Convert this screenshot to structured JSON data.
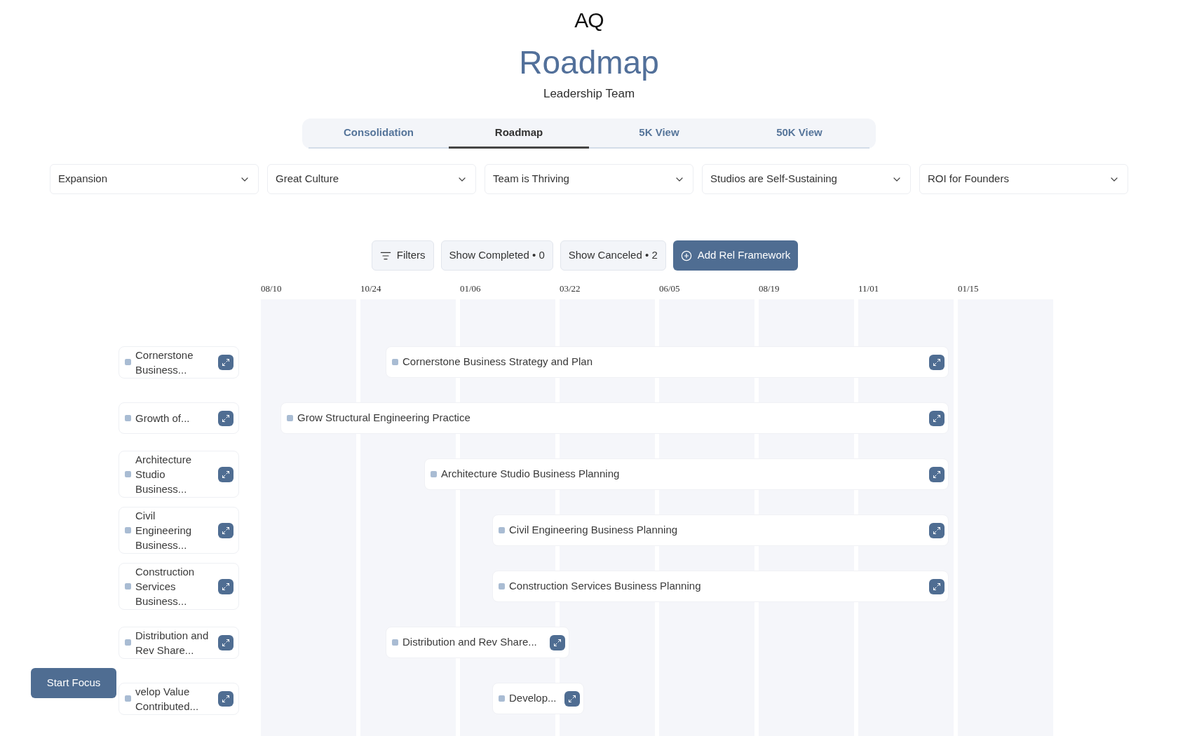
{
  "logo": "AQ",
  "title": "Roadmap",
  "subtitle": "Leadership Team",
  "tabs": [
    {
      "label": "Consolidation",
      "selected": false
    },
    {
      "label": "Roadmap",
      "selected": true
    },
    {
      "label": "5K View",
      "selected": false
    },
    {
      "label": "50K View",
      "selected": false
    }
  ],
  "goal_selects": [
    "Expansion",
    "Great Culture",
    "Team is Thriving",
    "Studios are Self-Sustaining",
    "ROI for Founders"
  ],
  "toolbar": [
    {
      "kind": "filter",
      "label": "Filters"
    },
    {
      "kind": "toggle",
      "label": "Show Completed • 0"
    },
    {
      "kind": "toggle",
      "label": "Show Canceled • 2"
    },
    {
      "kind": "primary",
      "label": "Add Rel Framework"
    }
  ],
  "timeline": {
    "dates": [
      "08/10",
      "10/24",
      "01/06",
      "03/22",
      "06/05",
      "08/19",
      "11/01",
      "01/15"
    ],
    "rows": [
      {
        "short_label": "Cornerstone Business...",
        "label": "Cornerstone Business Strategy and Plan"
      },
      {
        "short_label": "Growth of...",
        "label": "Grow Structural Engineering Practice"
      },
      {
        "short_label": "Architecture Studio Business...",
        "label": "Architecture Studio Business Planning"
      },
      {
        "short_label": "Civil Engineering Business...",
        "label": "Civil Engineering Business Planning"
      },
      {
        "short_label": "Construction Services Business...",
        "label": "Construction Services Business Planning"
      },
      {
        "short_label": "Distribution and Rev Share...",
        "label": "Distribution and Rev Share..."
      },
      {
        "short_label": "velop Value Contributed...",
        "label": "Develop..."
      }
    ]
  },
  "start_focus": "Start Focus"
}
